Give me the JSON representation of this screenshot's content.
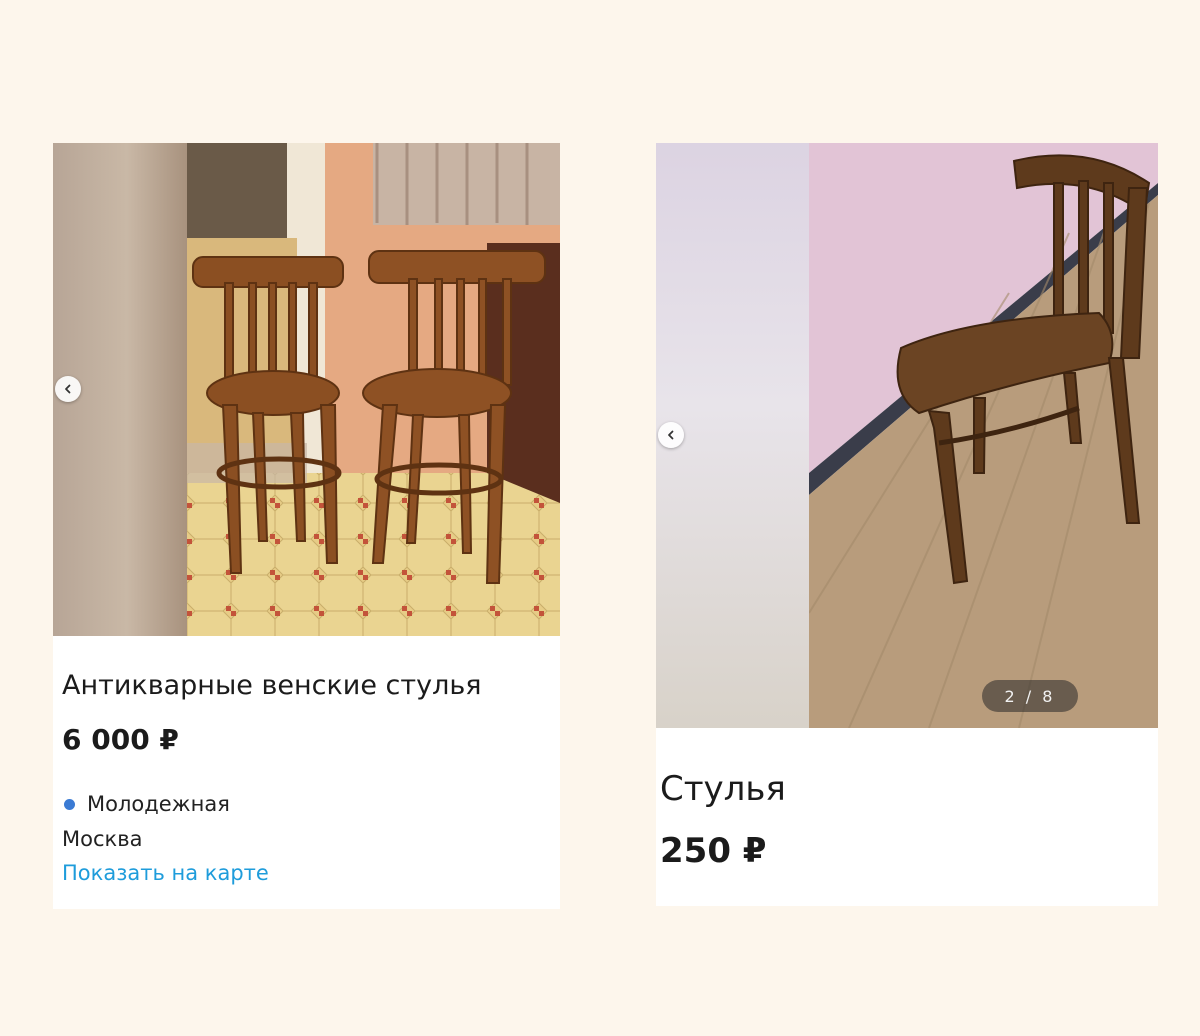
{
  "listings": [
    {
      "title": "Антикварные венские стулья",
      "price": "6 000 ₽",
      "metro_station": "Молодежная",
      "metro_color": "#3b7bd4",
      "city": "Москва",
      "map_link": "Показать на карте",
      "photo_subject": "two bentwood Vienna chairs on a tiled floor"
    },
    {
      "title": "Стулья",
      "price": "250 ₽",
      "photo_counter": "2 / 8",
      "photo_subject": "single bentwood chair on laminate floor"
    }
  ],
  "icons": {
    "prev": "chevron-left-icon"
  },
  "colors": {
    "background": "#fdf6ec",
    "link": "#1e9cdb"
  }
}
